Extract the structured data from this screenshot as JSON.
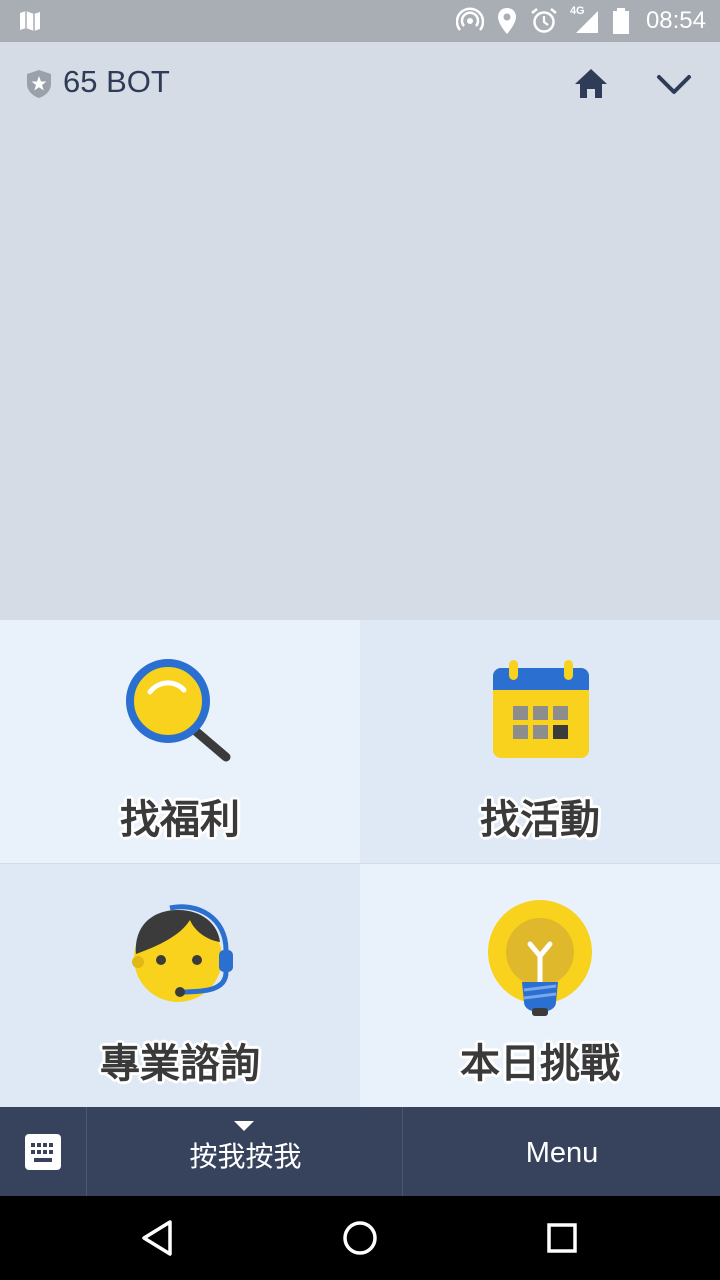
{
  "status_bar": {
    "time": "08:54",
    "network": "4G",
    "icons": [
      "map-icon",
      "hotspot-icon",
      "location-icon",
      "alarm-icon",
      "signal-icon",
      "battery-icon"
    ]
  },
  "header": {
    "bot_name": "65 BOT",
    "icons": [
      "shield-star-icon",
      "home-icon",
      "chevron-down-icon"
    ],
    "accent_color": "#2e3c58"
  },
  "rich_menu": {
    "tiles": [
      {
        "label": "找福利",
        "icon": "magnifier-icon"
      },
      {
        "label": "找活動",
        "icon": "calendar-icon"
      },
      {
        "label": "專業諮詢",
        "icon": "support-agent-icon"
      },
      {
        "label": "本日挑戰",
        "icon": "lightbulb-icon"
      }
    ],
    "colors": {
      "light": "#e9f1fb",
      "dark": "#dfe8f5",
      "yellow": "#f8d21c",
      "blue": "#2b6fd0"
    }
  },
  "bottom_bar": {
    "toggle_label": "按我按我",
    "menu_label": "Menu",
    "background": "#37435c"
  },
  "nav_bar": {
    "icons": [
      "back-icon",
      "home-circle-icon",
      "recents-icon"
    ]
  }
}
